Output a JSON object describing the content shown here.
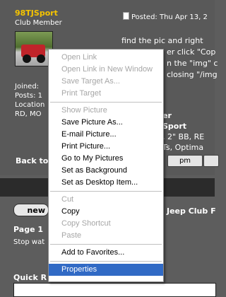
{
  "post": {
    "username": "98TJSport",
    "user_title": "Club Member",
    "meta_lines": "Joined: \nPosts: 1\nLocation\nRD, MO",
    "posted": "Posted: Thu Apr 13, 2",
    "body_lines": [
      "find the pic and right",
      "n the \"img\" c",
      "closing \"/img"
    ],
    "body_line1_tail": "er click \"Cop",
    "signature_lines": [
      "er",
      "Sport",
      ", 2\" BB, RE",
      "Ts, Optima"
    ],
    "back_to_label": "Back to",
    "pm_label": "pm"
  },
  "thread": {
    "new_button": "new",
    "title": "Jeep Club F",
    "page_label": "Page 1",
    "stop_text": "Stop wat",
    "quick_reply": "Quick R"
  },
  "context_menu": {
    "items": [
      {
        "label": "Open Link",
        "enabled": false
      },
      {
        "label": "Open Link in New Window",
        "enabled": false
      },
      {
        "label": "Save Target As...",
        "enabled": false
      },
      {
        "label": "Print Target",
        "enabled": false
      },
      {
        "separator": true
      },
      {
        "label": "Show Picture",
        "enabled": false
      },
      {
        "label": "Save Picture As...",
        "enabled": true
      },
      {
        "label": "E-mail Picture...",
        "enabled": true
      },
      {
        "label": "Print Picture...",
        "enabled": true
      },
      {
        "label": "Go to My Pictures",
        "enabled": true
      },
      {
        "label": "Set as Background",
        "enabled": true
      },
      {
        "label": "Set as Desktop Item...",
        "enabled": true
      },
      {
        "separator": true
      },
      {
        "label": "Cut",
        "enabled": false
      },
      {
        "label": "Copy",
        "enabled": true
      },
      {
        "label": "Copy Shortcut",
        "enabled": false
      },
      {
        "label": "Paste",
        "enabled": false
      },
      {
        "separator": true
      },
      {
        "label": "Add to Favorites...",
        "enabled": true
      },
      {
        "separator": true
      },
      {
        "label": "Properties",
        "enabled": true,
        "selected": true
      }
    ]
  },
  "colors": {
    "username": "#f5c400",
    "selection": "#316ac5",
    "disabled_text": "#a6a6a6"
  }
}
